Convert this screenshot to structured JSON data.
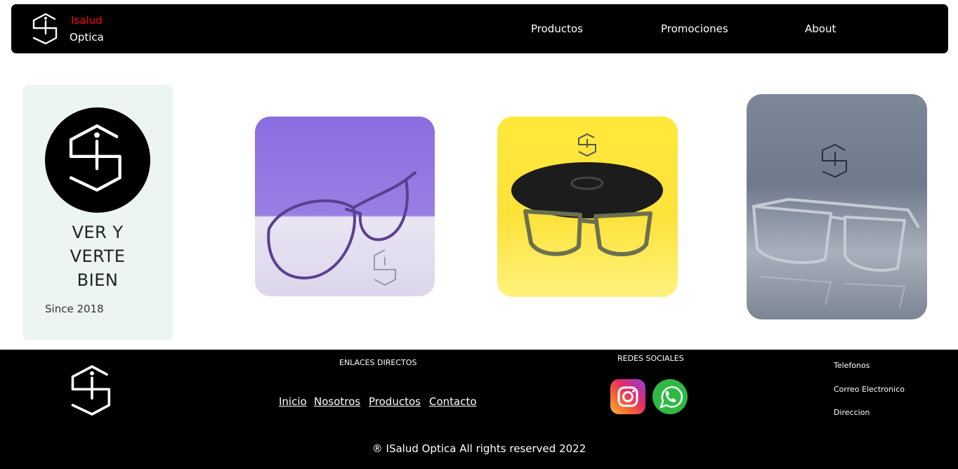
{
  "navbar": {
    "brand_line1": "Isalud",
    "brand_line2": "Optica",
    "links": [
      "Productos",
      "Promociones",
      "About"
    ]
  },
  "hero": {
    "tagline": [
      "VER Y",
      "VERTE",
      "BIEN"
    ],
    "since": "Since 2018"
  },
  "footer": {
    "links_heading": "ENLACES DIRECTOS",
    "links": [
      "Inicio",
      "Nosotros",
      "Productos",
      "Contacto"
    ],
    "social_heading": "REDES SOCIALES",
    "contact": [
      "Telefonos",
      "Correo Electronico",
      "Direccion"
    ],
    "copyright": "® ISalud Optica All rights reserved 2022"
  },
  "colors": {
    "navbar_bg": "#000000",
    "brand_accent": "#ff0000",
    "hero_card_bg": "#edf4f4",
    "footer_bg": "#000000"
  },
  "icons": [
    "isalud-logo-icon",
    "instagram-icon",
    "whatsapp-icon"
  ]
}
